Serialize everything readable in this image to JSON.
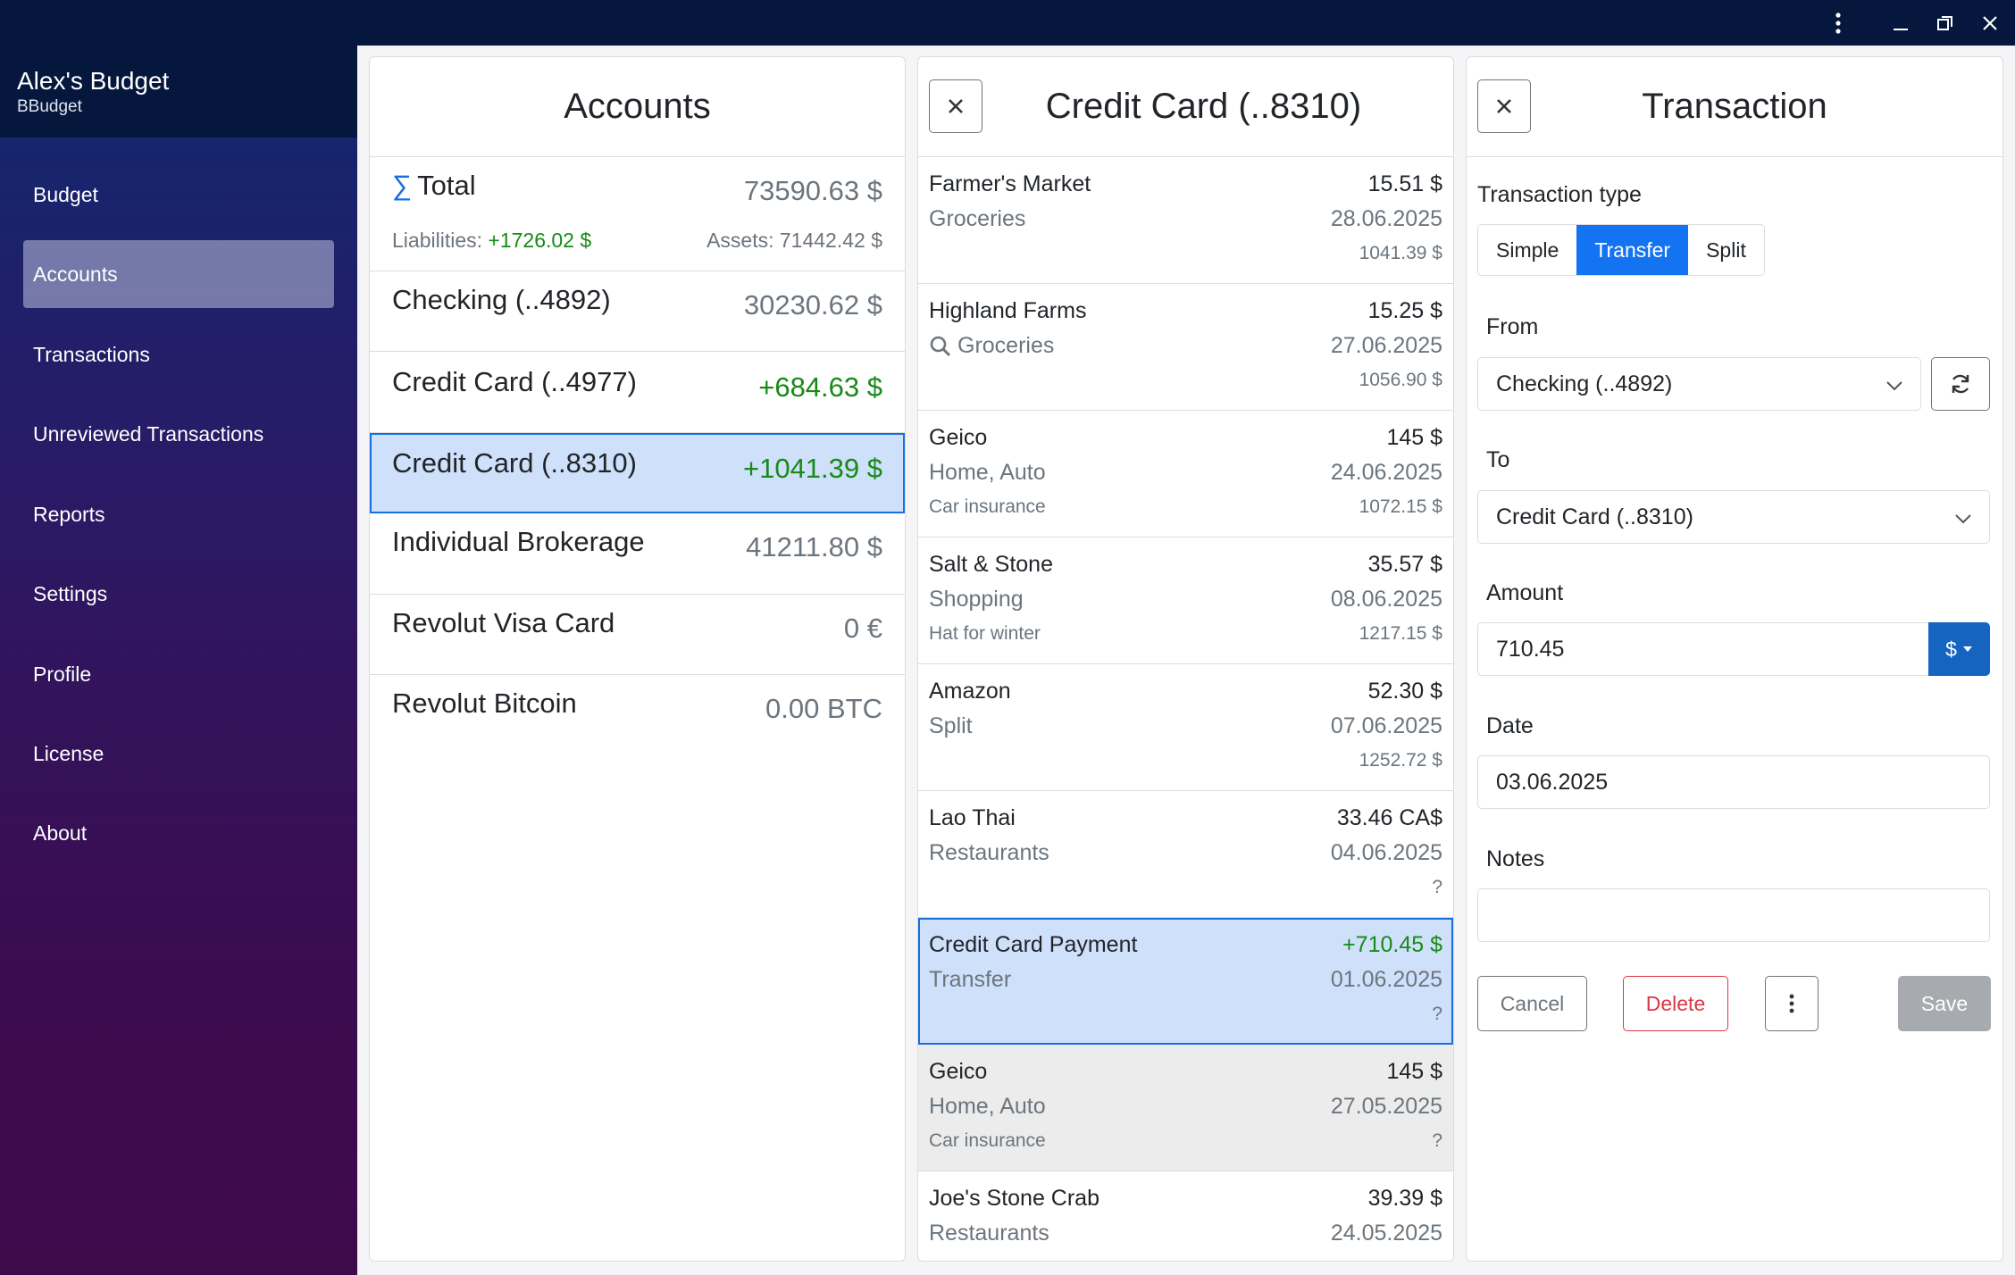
{
  "window": {
    "menu_icon": "kebab-menu-icon",
    "minimize_icon": "minimize-icon",
    "restore_icon": "restore-icon",
    "close_icon": "close-icon"
  },
  "sidebar": {
    "brand_title": "Alex's Budget",
    "brand_subtitle": "BBudget",
    "items": [
      {
        "label": "Budget"
      },
      {
        "label": "Accounts",
        "active": true
      },
      {
        "label": "Transactions"
      },
      {
        "label": "Unreviewed Transactions"
      },
      {
        "label": "Reports"
      },
      {
        "label": "Settings"
      },
      {
        "label": "Profile"
      },
      {
        "label": "License"
      },
      {
        "label": "About"
      }
    ]
  },
  "accounts": {
    "title": "Accounts",
    "total_symbol": "∑",
    "total_label": "Total",
    "total_value": "73590.63 $",
    "liabilities_label": "Liabilities:",
    "liabilities_value": "+1726.02 $",
    "assets_text": "Assets: 71442.42 $",
    "list": [
      {
        "name": "Checking (..4892)",
        "value": "30230.62 $"
      },
      {
        "name": "Credit Card (..4977)",
        "value": "+684.63 $",
        "positive": true
      },
      {
        "name": "Credit Card (..8310)",
        "value": "+1041.39 $",
        "positive": true,
        "selected": true
      },
      {
        "name": "Individual Brokerage",
        "value": "41211.80 $"
      },
      {
        "name": "Revolut Visa Card",
        "value": "0 €"
      },
      {
        "name": "Revolut Bitcoin",
        "value": "0.00 BTC"
      }
    ]
  },
  "transactions": {
    "title": "Credit Card (..8310)",
    "list": [
      {
        "payee": "Farmer's Market",
        "amount": "15.51 $",
        "category": "Groceries",
        "date": "28.06.2025",
        "note": "",
        "balance": "1041.39 $"
      },
      {
        "payee": "Highland Farms",
        "amount": "15.25 $",
        "category": "Groceries",
        "category_icon": "search-icon",
        "date": "27.06.2025",
        "note": "",
        "balance": "1056.90 $"
      },
      {
        "payee": "Geico",
        "amount": "145 $",
        "category": "Home, Auto",
        "date": "24.06.2025",
        "note": "Car insurance",
        "balance": "1072.15 $"
      },
      {
        "payee": "Salt & Stone",
        "amount": "35.57 $",
        "category": "Shopping",
        "date": "08.06.2025",
        "note": "Hat for winter",
        "balance": "1217.15 $"
      },
      {
        "payee": "Amazon",
        "amount": "52.30 $",
        "category": "Split",
        "date": "07.06.2025",
        "note": "",
        "balance": "1252.72 $"
      },
      {
        "payee": "Lao Thai",
        "amount": "33.46 CA$",
        "category": "Restaurants",
        "date": "04.06.2025",
        "note": "",
        "balance": "?"
      },
      {
        "payee": "Credit Card Payment",
        "amount": "+710.45 $",
        "positive": true,
        "selected": true,
        "category": "Transfer",
        "date": "01.06.2025",
        "note": "",
        "balance": "?"
      },
      {
        "payee": "Geico",
        "amount": "145 $",
        "muted": true,
        "category": "Home, Auto",
        "date": "27.05.2025",
        "note": "Car insurance",
        "balance": "?"
      },
      {
        "payee": "Joe's Stone Crab",
        "amount": "39.39 $",
        "category": "Restaurants",
        "date": "24.05.2025",
        "note": "",
        "balance": ""
      }
    ]
  },
  "form": {
    "title": "Transaction",
    "type_label": "Transaction type",
    "type_options": [
      "Simple",
      "Transfer",
      "Split"
    ],
    "type_selected": "Transfer",
    "from_label": "From",
    "from_value": "Checking (..4892)",
    "to_label": "To",
    "to_value": "Credit Card (..8310)",
    "amount_label": "Amount",
    "amount_value": "710.45",
    "currency": "$",
    "date_label": "Date",
    "date_value": "03.06.2025",
    "notes_label": "Notes",
    "notes_value": "",
    "cancel_label": "Cancel",
    "delete_label": "Delete",
    "save_label": "Save"
  },
  "colors": {
    "accent": "#1473f0",
    "positive": "#178a17",
    "danger": "#dc3545",
    "selection": "#cfe0fb"
  }
}
